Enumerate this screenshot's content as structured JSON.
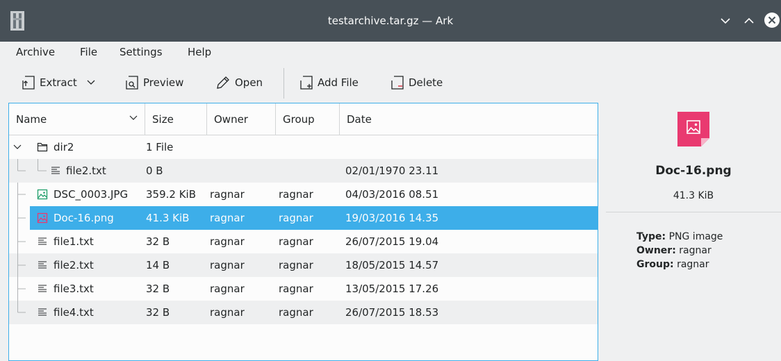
{
  "window": {
    "title": "testarchive.tar.gz — Ark"
  },
  "menubar": {
    "items": [
      "Archive",
      "File",
      "Settings",
      "Help"
    ]
  },
  "toolbar": {
    "extract": "Extract",
    "preview": "Preview",
    "open": "Open",
    "add_file": "Add File",
    "delete": "Delete"
  },
  "table": {
    "columns": [
      "Name",
      "Size",
      "Owner",
      "Group",
      "Date"
    ],
    "rows": [
      {
        "name": "dir2",
        "size": "1 File",
        "owner": "",
        "group": "",
        "date": "",
        "icon": "folder-icon"
      },
      {
        "name": "file2.txt",
        "size": "0 B",
        "owner": "",
        "group": "",
        "date": "02/01/1970 23.11",
        "icon": "text-file-icon"
      },
      {
        "name": "DSC_0003.JPG",
        "size": "359.2 KiB",
        "owner": "ragnar",
        "group": "ragnar",
        "date": "04/03/2016 08.51",
        "icon": "image-icon"
      },
      {
        "name": "Doc-16.png",
        "size": "41.3 KiB",
        "owner": "ragnar",
        "group": "ragnar",
        "date": "19/03/2016 14.35",
        "icon": "image-icon"
      },
      {
        "name": "file1.txt",
        "size": "32 B",
        "owner": "ragnar",
        "group": "ragnar",
        "date": "26/07/2015 19.04",
        "icon": "text-file-icon"
      },
      {
        "name": "file2.txt",
        "size": "14 B",
        "owner": "ragnar",
        "group": "ragnar",
        "date": "18/05/2015 14.57",
        "icon": "text-file-icon"
      },
      {
        "name": "file3.txt",
        "size": "32 B",
        "owner": "ragnar",
        "group": "ragnar",
        "date": "13/05/2015 17.26",
        "icon": "text-file-icon"
      },
      {
        "name": "file4.txt",
        "size": "32 B",
        "owner": "ragnar",
        "group": "ragnar",
        "date": "26/07/2015 18.53",
        "icon": "text-file-icon"
      }
    ]
  },
  "info": {
    "filename": "Doc-16.png",
    "size": "41.3 KiB",
    "type_label": "Type:",
    "type_value": "PNG image",
    "owner_label": "Owner:",
    "owner_value": "ragnar",
    "group_label": "Group:",
    "group_value": "ragnar"
  },
  "colors": {
    "titlebar": "#475057",
    "selection": "#3daee9",
    "image_icon_green": "#1f9e6a",
    "image_icon_pink": "#e93a70"
  }
}
